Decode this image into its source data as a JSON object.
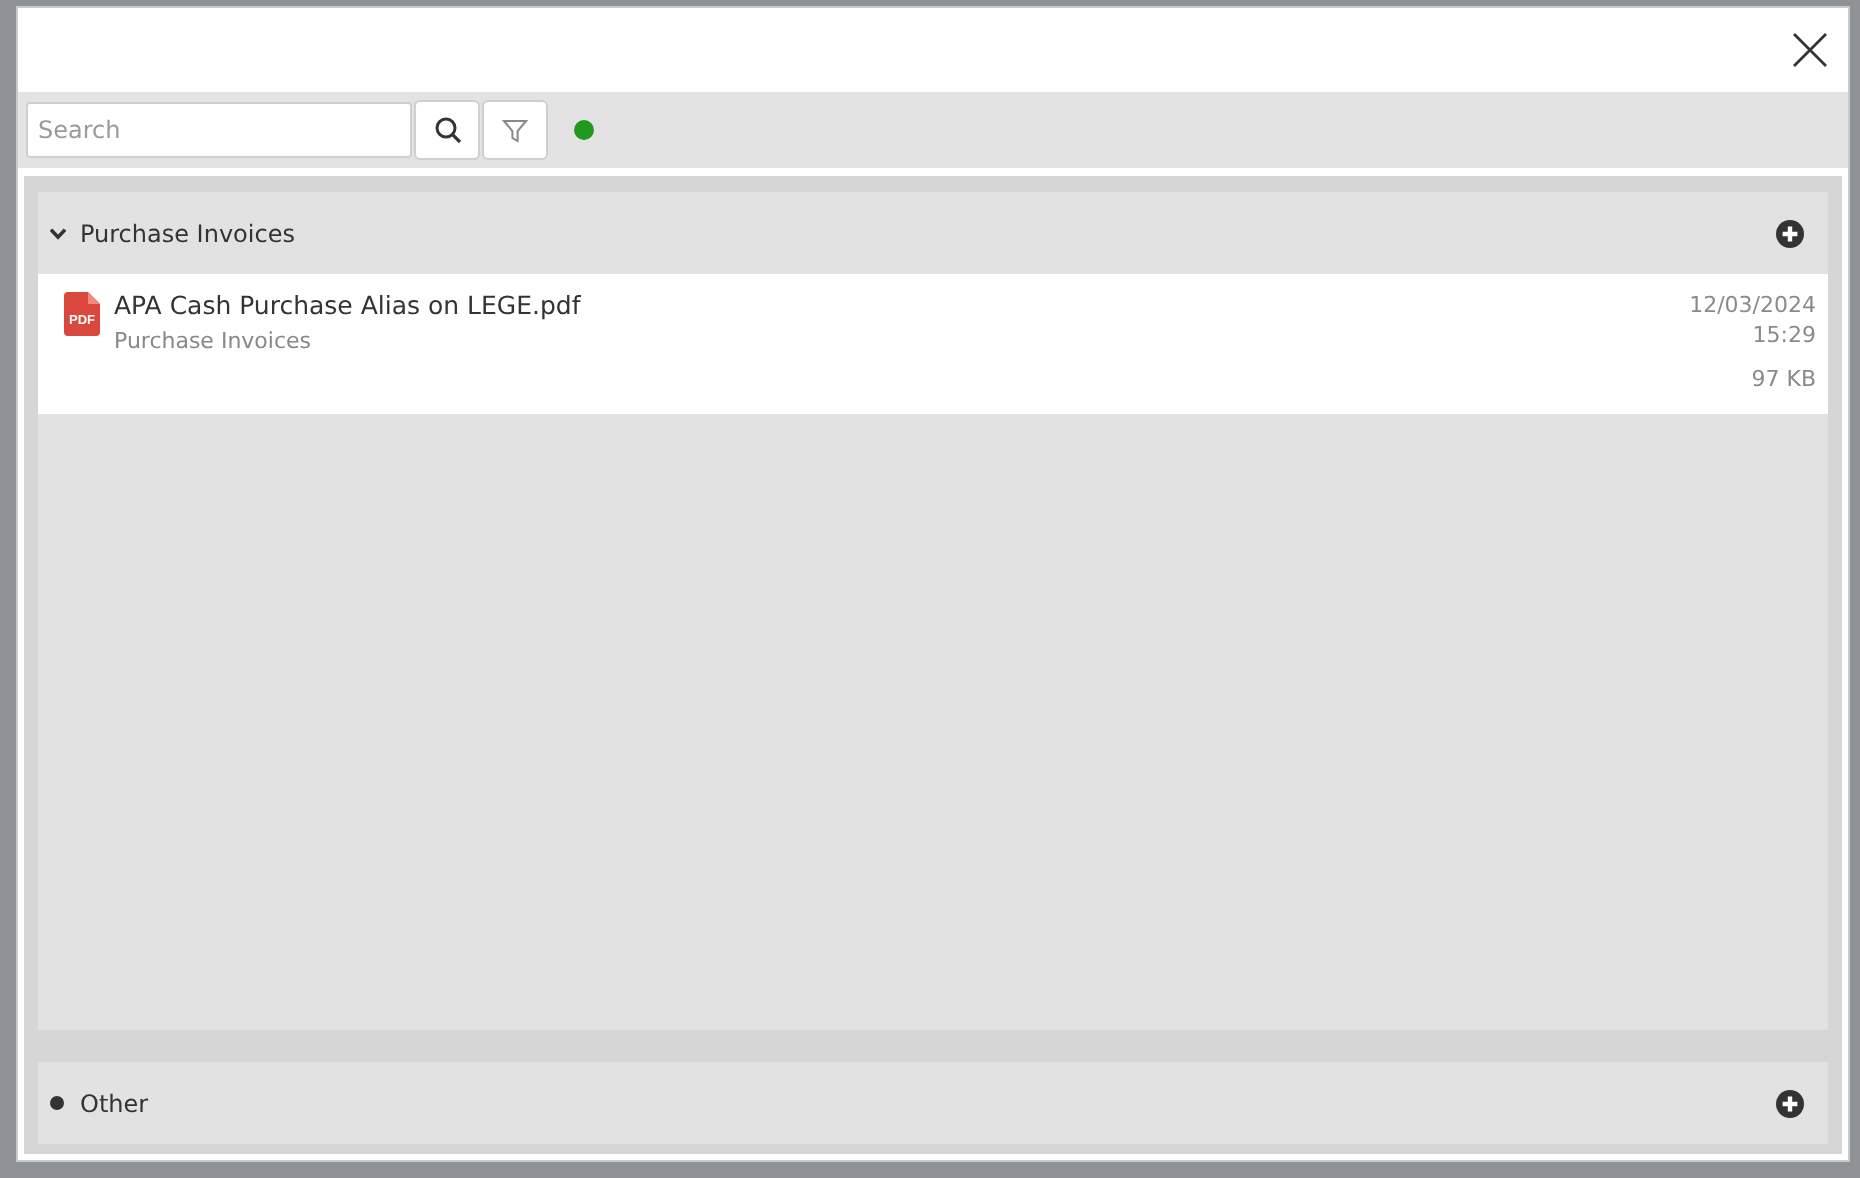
{
  "search": {
    "placeholder": "Search"
  },
  "connected": true,
  "groups": [
    {
      "title": "Purchase Invoices",
      "expanded": true,
      "files": [
        {
          "kind": "pdf",
          "badge": "PDF",
          "name": "APA Cash Purchase Alias on LEGE.pdf",
          "category": "Purchase Invoices",
          "date": "12/03/2024",
          "time": "15:29",
          "size": "97 KB"
        }
      ]
    },
    {
      "title": "Other",
      "expanded": false
    }
  ]
}
